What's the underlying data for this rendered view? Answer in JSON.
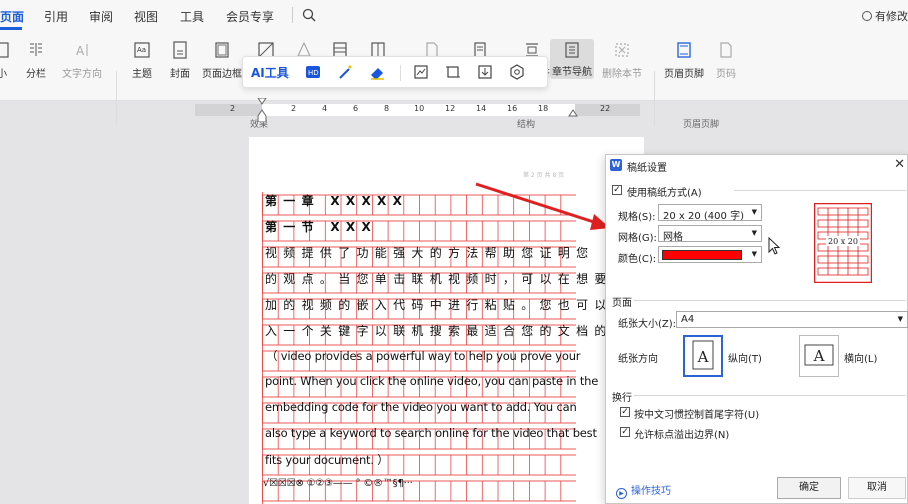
{
  "menubar": {
    "tabs": [
      {
        "label": "页面",
        "active": true
      },
      {
        "label": "引用",
        "active": false
      },
      {
        "label": "审阅",
        "active": false
      },
      {
        "label": "视图",
        "active": false
      },
      {
        "label": "工具",
        "active": false
      },
      {
        "label": "会员专享",
        "active": false
      }
    ],
    "share_label": "有修改"
  },
  "ribbon": {
    "buttons": [
      {
        "label": "小",
        "icon": "size-icon",
        "disabled": false
      },
      {
        "label": "分栏",
        "icon": "columns-icon",
        "disabled": false
      },
      {
        "label": "文字方向",
        "icon": "text-direction-icon",
        "disabled": true
      },
      {
        "label": "主题",
        "icon": "theme-icon",
        "disabled": false
      },
      {
        "label": "封面",
        "icon": "cover-icon",
        "disabled": false
      },
      {
        "label": "页面边框",
        "icon": "page-border-icon",
        "disabled": false
      },
      {
        "label": "",
        "icon": "watermark-icon",
        "disabled": false
      },
      {
        "label": "",
        "icon": "background-icon",
        "disabled": false
      },
      {
        "label": "",
        "icon": "page-icon",
        "disabled": false
      },
      {
        "label": "",
        "icon": "document-icon",
        "disabled": false
      },
      {
        "label": "",
        "icon": "insert-page-icon",
        "disabled": true
      },
      {
        "label": "",
        "icon": "section-icon",
        "disabled": false
      },
      {
        "label": "符",
        "icon": "separator-icon",
        "disabled": false
      },
      {
        "label": "章节导航",
        "icon": "chapter-nav-icon",
        "disabled": false
      },
      {
        "label": "删除本节",
        "icon": "delete-section-icon",
        "disabled": true
      },
      {
        "label": "页眉页脚",
        "icon": "header-footer-icon",
        "disabled": false
      },
      {
        "label": "页码",
        "icon": "page-number-icon",
        "disabled": true
      }
    ],
    "groups": [
      "效果",
      "结构",
      "页眉页脚"
    ]
  },
  "floating_toolbar": {
    "ai_label": "AI工具"
  },
  "ruler": {
    "numbers": [
      "2",
      "2",
      "2",
      "4",
      "6",
      "8",
      "10",
      "12",
      "14",
      "16",
      "18",
      "22"
    ]
  },
  "document": {
    "header_text": "第 2 页 共 8 页",
    "lines": [
      {
        "text": "第一章 XXXXX",
        "style": "cjk-bold"
      },
      {
        "text": "第一节 XXX",
        "style": "cjk-bold"
      },
      {
        "text": "  视频提供了功能强大的方法帮助您证明您",
        "style": "cjk"
      },
      {
        "text": "的观点。当您单击联机视频时，可以在想要添",
        "style": "cjk"
      },
      {
        "text": "加的视频的嵌入代码中进行粘贴。您也可以键",
        "style": "cjk"
      },
      {
        "text": "入一个关键字以联机搜索最适合您的文档的。",
        "style": "cjk"
      },
      {
        "text": "（ video provides a powerful way to help you prove your",
        "style": "eng"
      },
      {
        "text": "point. When you click the online video, you can paste in the",
        "style": "eng"
      },
      {
        "text": "embedding code for the video you want to add. You can",
        "style": "eng"
      },
      {
        "text": "also type a keyword to search online for the video that best",
        "style": "eng"
      },
      {
        "text": "fits your document. ）",
        "style": "eng"
      },
      {
        "text": "√☒☒☒⊗  ①②③——  °  ©®™§¶···",
        "style": "eng"
      }
    ]
  },
  "dialog": {
    "title": "稿纸设置",
    "use_paper_label": "使用稿纸方式(A)",
    "use_paper_checked": true,
    "spec_label": "规格(S):",
    "spec_value": "20 x 20 (400 字)",
    "grid_label": "网格(G):",
    "grid_value": "网格",
    "color_label": "颜色(C):",
    "color_value": "#ff0000",
    "preview_text": "20 x 20",
    "page_section": "页面",
    "paper_size_label": "纸张大小(Z):",
    "paper_size_value": "A4",
    "orientation_label": "纸张方向",
    "portrait_label": "纵向(T)",
    "landscape_label": "横向(L)",
    "orientation_selected": "portrait",
    "wrap_section": "换行",
    "wrap_option1_label": "按中文习惯控制首尾字符(U)",
    "wrap_option1_checked": true,
    "wrap_option2_label": "允许标点溢出边界(N)",
    "wrap_option2_checked": true,
    "tips_label": "操作技巧",
    "ok_label": "确定",
    "cancel_label": "取消"
  }
}
